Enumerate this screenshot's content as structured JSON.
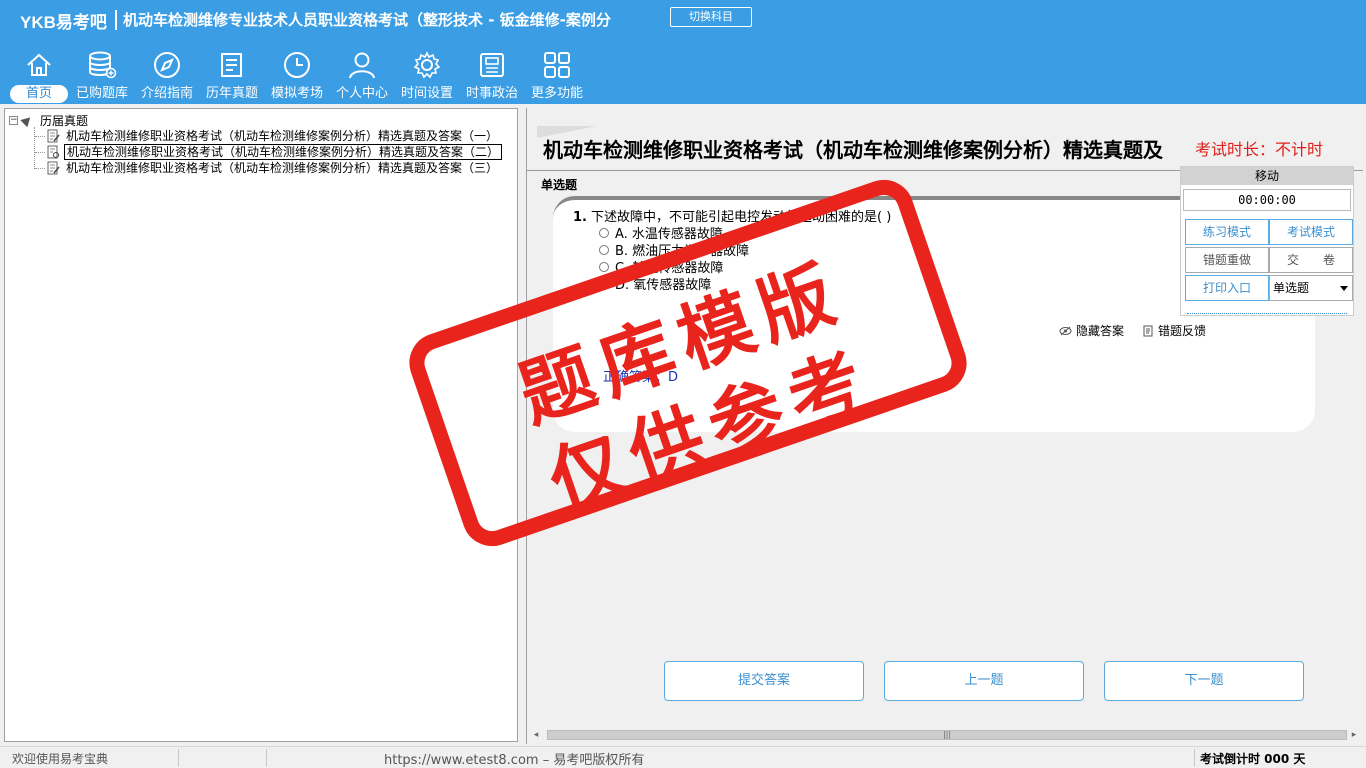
{
  "header": {
    "logo": "YKB易考吧",
    "title": "机动车检测维修专业技术人员职业资格考试（整形技术 - 钣金维修-案例分",
    "switch_label": "切换科目"
  },
  "nav": {
    "items": [
      {
        "label": "首页",
        "icon": "home-icon"
      },
      {
        "label": "已购题库",
        "icon": "database-icon"
      },
      {
        "label": "介绍指南",
        "icon": "compass-icon"
      },
      {
        "label": "历年真题",
        "icon": "list-icon"
      },
      {
        "label": "模拟考场",
        "icon": "clock-icon"
      },
      {
        "label": "个人中心",
        "icon": "user-icon"
      },
      {
        "label": "时间设置",
        "icon": "gear-icon"
      },
      {
        "label": "时事政治",
        "icon": "news-icon"
      },
      {
        "label": "更多功能",
        "icon": "grid-icon"
      }
    ]
  },
  "tree": {
    "root": "历届真题",
    "items": [
      "机动车检测维修职业资格考试（机动车检测维修案例分析）精选真题及答案（一）",
      "机动车检测维修职业资格考试（机动车检测维修案例分析）精选真题及答案（二）",
      "机动车检测维修职业资格考试（机动车检测维修案例分析）精选真题及答案（三）"
    ]
  },
  "question": {
    "page_title": "机动车检测维修职业资格考试（机动车检测维修案例分析）精选真题及",
    "title_overlay": "考试时长：不计时",
    "section_type": "单选题",
    "number": "1.",
    "text": "下述故障中，不可能引起电控发动机起动困难的是( )",
    "options": [
      "A. 水温传感器故障",
      "B. 燃油压力调节器故障",
      "C. 转速传感器故障",
      "D. 氧传感器故障"
    ],
    "hide_answer": "隐藏答案",
    "feedback": "错题反馈",
    "answer": "正确答案：D"
  },
  "buttons": {
    "submit": "提交答案",
    "prev": "上一题",
    "next": "下一题"
  },
  "control": {
    "move": "移动",
    "timer": "00:00:00",
    "practice_mode": "练习模式",
    "exam_mode": "考试模式",
    "redo_wrong": "错题重做",
    "hand_in": "交　　卷",
    "print": "打印入口",
    "type_select": "单选题"
  },
  "watermark": {
    "line1": "题库模版",
    "line2": "仅供参考"
  },
  "status": {
    "welcome": "欢迎使用易考宝典",
    "copyright": "https://www.etest8.com – 易考吧版权所有",
    "countdown": "考试倒计时 000 天"
  },
  "colors": {
    "header_bg": "#3b9ee5",
    "accent": "#3a8fd0",
    "stamp_red": "#e8241c",
    "answer_blue": "#1a33b3"
  }
}
